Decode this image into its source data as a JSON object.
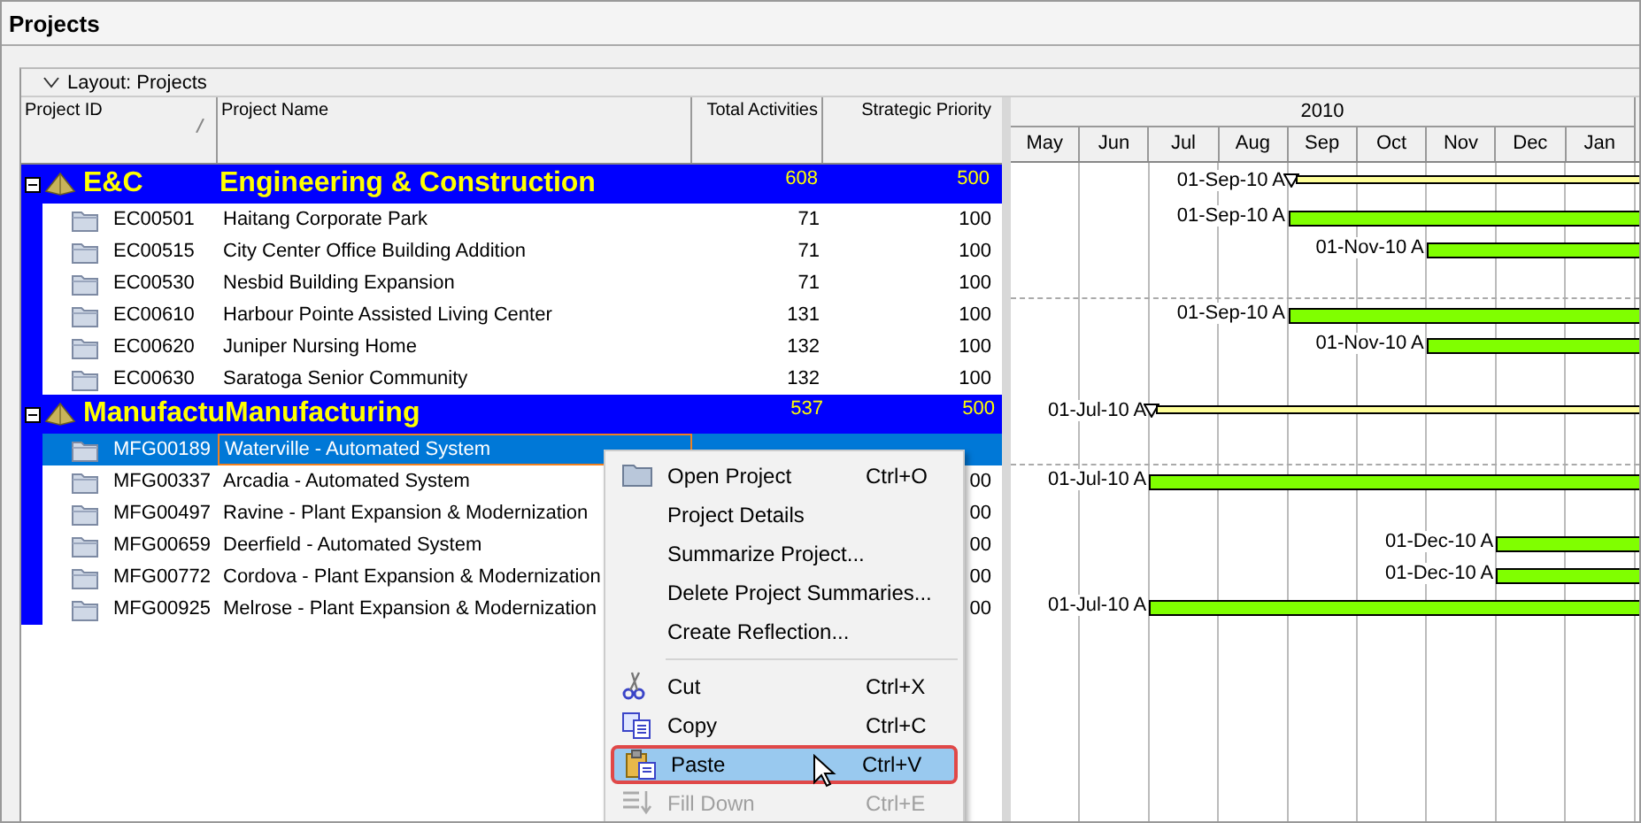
{
  "window": {
    "title": "Projects"
  },
  "layout": {
    "label": "Layout: Projects",
    "expanded": true
  },
  "columns": [
    "Project ID",
    "Project Name",
    "Total Activities",
    "Strategic Priority"
  ],
  "timeline": {
    "year": "2010",
    "months": [
      "May",
      "Jun",
      "Jul",
      "Aug",
      "Sep",
      "Oct",
      "Nov",
      "Dec",
      "Jan"
    ]
  },
  "groups": [
    {
      "id": "E&C",
      "name": "Engineering & Construction",
      "total": "608",
      "priority": "500",
      "expanded": true,
      "bar": {
        "kind": "summary",
        "label": "01-Sep-10 A"
      },
      "projects": [
        {
          "id": "EC00501",
          "name": "Haitang Corporate Park",
          "total": "71",
          "priority": "100",
          "selected": false,
          "bar": {
            "kind": "project",
            "label": "01-Sep-10 A"
          }
        },
        {
          "id": "EC00515",
          "name": "City Center Office Building Addition",
          "total": "71",
          "priority": "100",
          "selected": false,
          "bar": {
            "kind": "project",
            "label": "01-Nov-10 A"
          }
        },
        {
          "id": "EC00530",
          "name": "Nesbid Building Expansion",
          "total": "71",
          "priority": "100",
          "selected": false
        },
        {
          "id": "EC00610",
          "name": "Harbour Pointe Assisted Living Center",
          "total": "131",
          "priority": "100",
          "selected": false,
          "bar": {
            "kind": "project",
            "label": "01-Sep-10 A"
          }
        },
        {
          "id": "EC00620",
          "name": "Juniper Nursing Home",
          "total": "132",
          "priority": "100",
          "selected": false,
          "bar": {
            "kind": "project",
            "label": "01-Nov-10 A"
          }
        },
        {
          "id": "EC00630",
          "name": "Saratoga Senior Community",
          "total": "132",
          "priority": "100",
          "selected": false
        }
      ]
    },
    {
      "id": "Manufactu",
      "name": "Manufacturing",
      "total": "537",
      "priority": "500",
      "expanded": true,
      "bar": {
        "kind": "summary",
        "label": "01-Jul-10 A"
      },
      "projects": [
        {
          "id": "MFG00189",
          "name": "Waterville - Automated System",
          "selected": true
        },
        {
          "id": "MFG00337",
          "name": "Arcadia - Automated System",
          "priority": "00",
          "selected": false,
          "bar": {
            "kind": "project",
            "label": "01-Jul-10 A"
          }
        },
        {
          "id": "MFG00497",
          "name": "Ravine - Plant Expansion & Modernization",
          "priority": "00",
          "selected": false
        },
        {
          "id": "MFG00659",
          "name": "Deerfield - Automated System",
          "priority": "00",
          "selected": false,
          "bar": {
            "kind": "project",
            "label": "01-Dec-10 A"
          }
        },
        {
          "id": "MFG00772",
          "name": "Cordova - Plant Expansion & Modernization",
          "priority": "00",
          "selected": false,
          "bar": {
            "kind": "project",
            "label": "01-Dec-10 A"
          }
        },
        {
          "id": "MFG00925",
          "name": "Melrose - Plant Expansion & Modernization",
          "priority": "00",
          "selected": false,
          "bar": {
            "kind": "project",
            "label": "01-Jul-10 A"
          }
        }
      ]
    }
  ],
  "context_menu": [
    {
      "kind": "item",
      "label": "Open Project",
      "shortcut": "Ctrl+O",
      "disabled": false,
      "selected": false
    },
    {
      "kind": "item",
      "label": "Project Details",
      "disabled": false,
      "selected": false
    },
    {
      "kind": "item",
      "label": "Summarize Project...",
      "disabled": false,
      "selected": false
    },
    {
      "kind": "item",
      "label": "Delete Project Summaries...",
      "disabled": false,
      "selected": false
    },
    {
      "kind": "item",
      "label": "Create Reflection...",
      "disabled": false,
      "selected": false
    },
    {
      "kind": "separator"
    },
    {
      "kind": "item",
      "label": "Cut",
      "shortcut": "Ctrl+X",
      "disabled": false,
      "selected": false
    },
    {
      "kind": "item",
      "label": "Copy",
      "shortcut": "Ctrl+C",
      "disabled": false,
      "selected": false
    },
    {
      "kind": "item",
      "label": "Paste",
      "shortcut": "Ctrl+V",
      "disabled": false,
      "selected": true
    },
    {
      "kind": "item",
      "label": "Fill Down",
      "shortcut": "Ctrl+E",
      "disabled": true,
      "selected": false
    }
  ]
}
